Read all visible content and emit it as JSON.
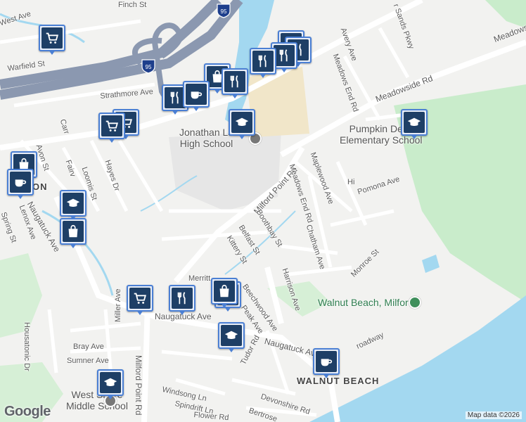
{
  "map": {
    "attribution": "Map data ©2026",
    "logo": "Google",
    "colors": {
      "land": "#f2f2f0",
      "water": "#a3d8f0",
      "park": "#c9eccb",
      "highway": "#8b98b0",
      "road": "#ffffff",
      "school_area": "#e6e6e6",
      "parking": "#f1e6c9",
      "marker_fill": "#1e3f66",
      "marker_border": "#4a7fd4"
    },
    "interstate_shield": "95",
    "places": [
      {
        "name": "Jonathan Law High School",
        "line1": "Jonathan La",
        "line2": "High School",
        "type": "school"
      },
      {
        "name": "Pumpkin Delight Elementary School",
        "line1": "Pumpkin Delig",
        "line2": "Elementary School",
        "type": "school"
      },
      {
        "name": "Walnut Beach, Milford",
        "line1": "Walnut Beach, Milford",
        "type": "park"
      },
      {
        "name": "West Shore Middle School",
        "line1": "West Shore",
        "line2": "Middle School",
        "type": "school"
      },
      {
        "name": "WALNUT BEACH",
        "line1": "WALNUT BEACH",
        "type": "area"
      },
      {
        "name": "ON",
        "line1": "ON",
        "type": "area"
      }
    ],
    "streets": [
      {
        "label": "West Ave"
      },
      {
        "label": "Finch St"
      },
      {
        "label": "Warfield St"
      },
      {
        "label": "Strathmore Ave"
      },
      {
        "label": "Meadowside Rd"
      },
      {
        "label": "Meadows"
      },
      {
        "label": "Avery Ave"
      },
      {
        "label": "Meadows End Rd"
      },
      {
        "label": "r Sands Pkwy"
      },
      {
        "label": "Maplewood Ave"
      },
      {
        "label": "Pomona Ave"
      },
      {
        "label": "Milford Point Rd"
      },
      {
        "label": "Meadows End Rd"
      },
      {
        "label": "Boothbay St"
      },
      {
        "label": "Belfast St"
      },
      {
        "label": "Kittery St"
      },
      {
        "label": "Chatham Ave"
      },
      {
        "label": "Monroe St"
      },
      {
        "label": "Harrison Ave"
      },
      {
        "label": "Merritt"
      },
      {
        "label": "Beechwood Ave"
      },
      {
        "label": "Peak Ave"
      },
      {
        "label": "Naugatuck Ave"
      },
      {
        "label": "Naugatuck Ave"
      },
      {
        "label": "Naugatuck Ave"
      },
      {
        "label": "Tudor Rd"
      },
      {
        "label": "Milford Point Rd"
      },
      {
        "label": "Miller Ave"
      },
      {
        "label": "Bray Ave"
      },
      {
        "label": "Sumner Ave"
      },
      {
        "label": "Housatonic Dr"
      },
      {
        "label": "Windsong Ln"
      },
      {
        "label": "Spindrift Ln"
      },
      {
        "label": "Flower Rd"
      },
      {
        "label": "Devonshire Rd"
      },
      {
        "label": "Bertrose"
      },
      {
        "label": "Hayes Dr"
      },
      {
        "label": "Loomis St"
      },
      {
        "label": "Fairv"
      },
      {
        "label": "Avon St"
      },
      {
        "label": "Carr"
      },
      {
        "label": "Lenox Ave"
      },
      {
        "label": "Spring St"
      },
      {
        "label": "Hi"
      },
      {
        "label": "roadway"
      }
    ],
    "markers": [
      {
        "icon": "cart-icon",
        "category": "grocery"
      },
      {
        "icon": "cart-icon",
        "category": "grocery"
      },
      {
        "icon": "fork-knife-icon",
        "category": "restaurant"
      },
      {
        "icon": "fork-knife-icon",
        "category": "restaurant"
      },
      {
        "icon": "fork-knife-icon",
        "category": "restaurant"
      },
      {
        "icon": "bag-icon",
        "category": "shopping"
      },
      {
        "icon": "fork-knife-icon",
        "category": "restaurant"
      },
      {
        "icon": "school-icon",
        "category": "school"
      },
      {
        "icon": "school-icon",
        "category": "school"
      },
      {
        "icon": "fork-knife-icon",
        "category": "restaurant"
      },
      {
        "icon": "coffee-icon",
        "category": "cafe"
      },
      {
        "icon": "cart-icon",
        "category": "grocery"
      },
      {
        "icon": "cart-icon",
        "category": "grocery"
      },
      {
        "icon": "bag-icon",
        "category": "shopping"
      },
      {
        "icon": "coffee-icon",
        "category": "cafe"
      },
      {
        "icon": "school-icon",
        "category": "school"
      },
      {
        "icon": "bag-icon",
        "category": "shopping"
      },
      {
        "icon": "bag-icon",
        "category": "shopping"
      },
      {
        "icon": "cart-icon",
        "category": "grocery"
      },
      {
        "icon": "fork-knife-icon",
        "category": "restaurant"
      },
      {
        "icon": "bag-icon",
        "category": "shopping"
      },
      {
        "icon": "school-icon",
        "category": "school"
      },
      {
        "icon": "coffee-icon",
        "category": "cafe"
      },
      {
        "icon": "school-icon",
        "category": "school"
      }
    ]
  }
}
